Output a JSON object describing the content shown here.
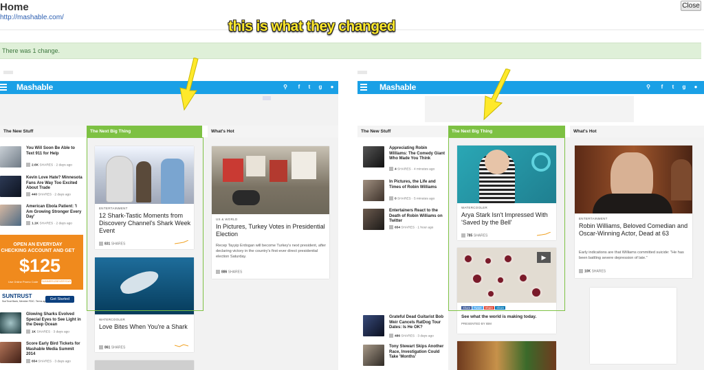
{
  "header": {
    "title": "Home",
    "url": "http://mashable.com/",
    "close_label": "Close"
  },
  "annotation": "this is what they changed",
  "banner": "There was 1 change.",
  "site": {
    "logo": "Mashable",
    "col_new": "The New Stuff",
    "col_next": "The Next Big Thing",
    "col_hot": "What's Hot",
    "shares": "SHARES"
  },
  "left_page": {
    "new_stuff": [
      {
        "title": "You Will Soon Be Able to Text 911 for Help",
        "count": "2.6K",
        "ago": "2 days ago"
      },
      {
        "title": "Kevin Love Hate? Minnesota Fans Are Way Too Excited About Trade",
        "count": "440",
        "ago": "2 days ago"
      },
      {
        "title": "American Ebola Patient: 'I Am Growing Stronger Every Day'",
        "count": "1.1K",
        "ago": "2 days ago"
      },
      {
        "title": "Glowing Sharks Evolved Special Eyes to See Light in the Deep Ocean",
        "count": "1K",
        "ago": "3 days ago"
      },
      {
        "title": "Score Early Bird Tickets for Mashable Media Summit 2014",
        "count": "654",
        "ago": "3 days ago"
      }
    ],
    "ad": {
      "line1": "OPEN AN EVERYDAY CHECKING ACCOUNT AND GET",
      "amount": "$125",
      "small": "Use Online Promo Code",
      "code": "SUMMER125EVERYDAY",
      "brand": "SUNTRUST",
      "tiny": "SunTrust Bank, Member FDIC. Terms apply.",
      "cta": "Get Started"
    },
    "next": [
      {
        "category": "ENTERTAINMENT",
        "title": "12 Shark-Tastic Moments from Discovery Channel's Shark Week Event",
        "count": "831"
      },
      {
        "category": "WATERCOOLER",
        "title": "Love Bites When You're a Shark",
        "count": "861"
      }
    ],
    "hot": {
      "category": "US & WORLD",
      "title": "In Pictures, Turkey Votes in Presidential Election",
      "desc": "Recep Tayyip Erdogan will become Turkey's next president, after declaring victory in the country's first-ever direct presidential election Saturday.",
      "count": "886"
    }
  },
  "right_page": {
    "new_stuff": [
      {
        "title": "Appreciating Robin Williams: The Comedy Giant Who Made You Think",
        "count": "4",
        "ago": "4 minutes ago"
      },
      {
        "title": "In Pictures, the Life and Times of Robin Williams",
        "count": "0",
        "ago": "5 minutes ago"
      },
      {
        "title": "Entertainers React to the Death of Robin Williams on Twitter",
        "count": "654",
        "ago": "1 hour ago"
      },
      {
        "title": "Grateful Dead Guitarist Bob Weir Cancels RatDog Tour Dates: Is He OK?",
        "count": "486",
        "ago": "3 days ago"
      },
      {
        "title": "Tony Stewart Skips Another Race, Investigation Could Take 'Months'",
        "count": "",
        "ago": ""
      }
    ],
    "next": [
      {
        "category": "WATERCOOLER",
        "title": "Arya Stark Isn't Impressed With 'Saved by the Bell'",
        "count": "785"
      }
    ],
    "video": {
      "caption": "See what the world is making today.",
      "presented": "PRESENTED BY IBM",
      "share_labels": [
        "Share",
        "Tweet",
        "Share",
        "Share"
      ]
    },
    "hot": {
      "category": "ENTERTAINMENT",
      "title": "Robin Williams, Beloved Comedian and Oscar-Winning Actor, Dead at 63",
      "desc": "Early indications are that Williams committed suicide: \"He has been battling severe depression of late.\"",
      "count": "10K"
    }
  }
}
